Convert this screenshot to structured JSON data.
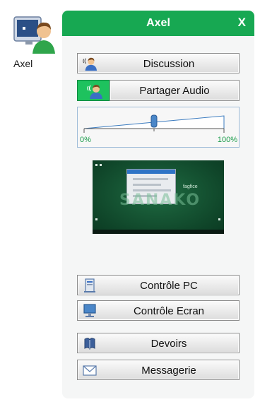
{
  "user": {
    "name": "Axel"
  },
  "panel": {
    "title": "Axel",
    "close_label": "X",
    "accent_color": "#17a852",
    "buttons": {
      "discussion": "Discussion",
      "share_audio": "Partager Audio",
      "pc_control": "Contrôle PC",
      "screen_control": "Contrôle Ecran",
      "homework": "Devoirs",
      "messaging": "Messagerie"
    },
    "volume": {
      "min_label": "0%",
      "max_label": "100%",
      "level": 0.5
    },
    "screen_preview": {
      "logo": "SANAKO",
      "caption": "fagfice"
    }
  },
  "icons": {
    "user": "student-avatar-icon",
    "discussion": "speaking-person-icon",
    "share_audio": "speaking-person-icon",
    "pc_control": "pc-tower-icon",
    "screen_control": "monitor-icon",
    "homework": "book-icon",
    "messaging": "envelope-icon"
  }
}
